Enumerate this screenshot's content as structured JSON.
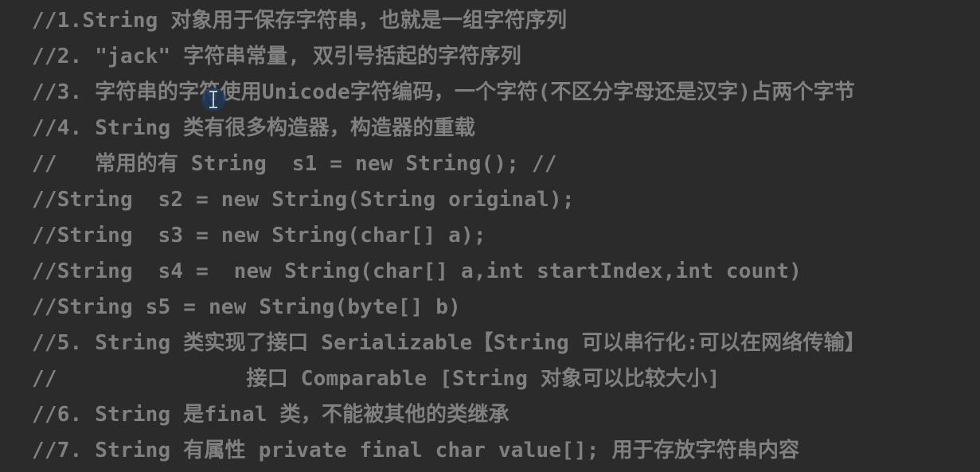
{
  "editor": {
    "background": "#2b2b2b",
    "comment_color": "#808080",
    "lines": [
      "//1.String 对象用于保存字符串，也就是一组字符序列",
      "//2. \"jack\" 字符串常量, 双引号括起的字符序列",
      "//3. 字符串的字符使用Unicode字符编码，一个字符(不区分字母还是汉字)占两个字节",
      "//4. String 类有很多构造器，构造器的重载",
      "//   常用的有 String  s1 = new String(); //",
      "//String  s2 = new String(String original);",
      "//String  s3 = new String(char[] a);",
      "//String  s4 =  new String(char[] a,int startIndex,int count)",
      "//String s5 = new String(byte[] b)",
      "//5. String 类实现了接口 Serializable【String 可以串行化:可以在网络传输】",
      "//               接口 Comparable [String 对象可以比较大小]",
      "//6. String 是final 类，不能被其他的类继承",
      "//7. String 有属性 private final char value[]; 用于存放字符串内容"
    ]
  }
}
